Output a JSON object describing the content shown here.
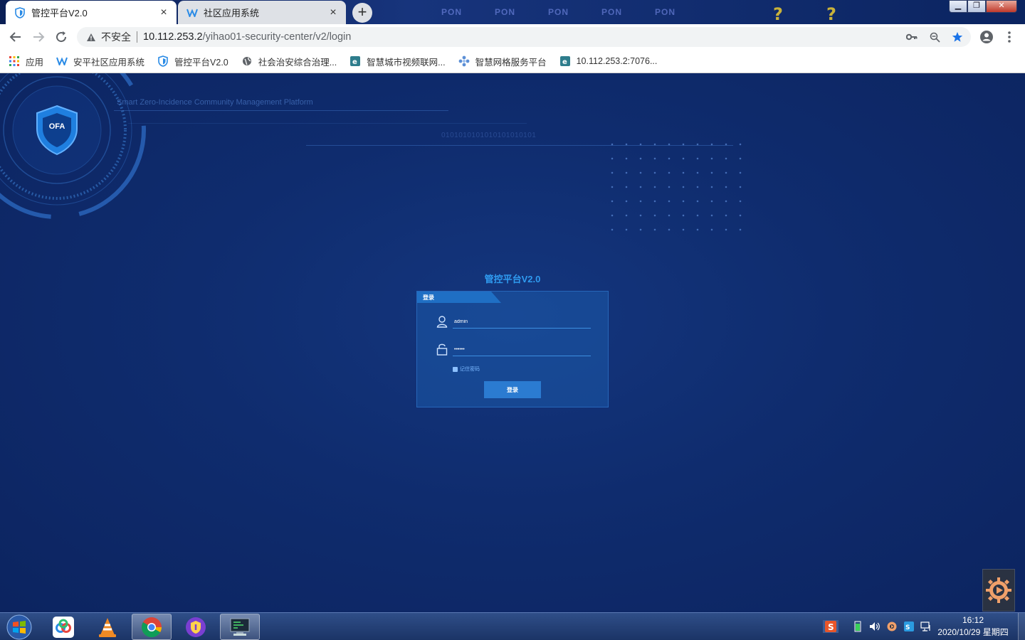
{
  "browser": {
    "tabs": [
      {
        "title": "管控平台V2.0",
        "active": true
      },
      {
        "title": "社区应用系统",
        "active": false
      }
    ],
    "new_tab_symbol": "+",
    "close_symbol": "×",
    "deco_items": [
      "PON",
      "PON",
      "PON",
      "PON",
      "PON"
    ],
    "omnibox": {
      "security_label": "不安全",
      "url_host": "10.112.253.2",
      "url_path": "/yihao01-security-center/v2/login"
    },
    "bookmarks": [
      {
        "label": "应用",
        "icon": "apps-grid-icon"
      },
      {
        "label": "安平社区应用系统",
        "icon": "w-logo-icon"
      },
      {
        "label": "管控平台V2.0",
        "icon": "shield-icon"
      },
      {
        "label": "社会治安综合治理...",
        "icon": "globe-icon"
      },
      {
        "label": "智慧城市视频联网...",
        "icon": "e-logo-icon"
      },
      {
        "label": "智慧网格服务平台",
        "icon": "grid-flower-icon"
      },
      {
        "label": "10.112.253.2:7076...",
        "icon": "e-logo-icon"
      }
    ]
  },
  "page": {
    "subtitle": "Smart Zero-Incidence Community Management Platform",
    "binary": "0101010101010101010101",
    "logo_text": "OFA",
    "login": {
      "title": "管控平台V2.0",
      "tab_label": "登录",
      "username_value": "admin",
      "password_value": "••••••",
      "remember_label": "记住密码",
      "submit_label": "登录"
    }
  },
  "taskbar": {
    "time": "16:12",
    "date": "2020/10/29 星期四"
  },
  "colors": {
    "page_bg": "#0f2c6e",
    "accent": "#2f9bf0",
    "login_button": "#2b7bd1"
  }
}
